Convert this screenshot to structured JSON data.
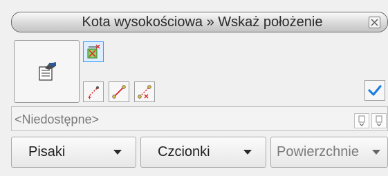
{
  "window": {
    "title": "Kota wysokościowa » Wskaż położenie"
  },
  "toolbar": {
    "properties_icon": "properties-icon",
    "point_tools": [
      "add-point-icon",
      "segment-icon",
      "remove-point-icon"
    ],
    "delete_mark_icon": "delete-mark-icon",
    "confirm_icon": "checkmark-icon",
    "confirm_color": "#1e7fe0"
  },
  "layer_dropdown": {
    "value": "<Niedostępne>"
  },
  "bottom_buttons": {
    "pens": "Pisaki",
    "fonts": "Czcionki",
    "surfaces": "Powierzchnie"
  }
}
